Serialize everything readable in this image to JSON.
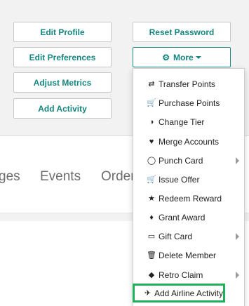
{
  "actions": {
    "edit_profile": "Edit Profile",
    "edit_preferences": "Edit Preferences",
    "adjust_metrics": "Adjust Metrics",
    "add_activity": "Add Activity",
    "reset_password": "Reset Password",
    "more": "More"
  },
  "tabs": [
    "ges",
    "Events",
    "Orders"
  ],
  "menu": [
    {
      "label": "Transfer Points",
      "icon": "transfer-icon",
      "submenu": false
    },
    {
      "label": "Purchase Points",
      "icon": "cart-icon",
      "submenu": false
    },
    {
      "label": "Change Tier",
      "icon": "half-circle-icon",
      "submenu": false
    },
    {
      "label": "Merge Accounts",
      "icon": "handshake-icon",
      "submenu": false
    },
    {
      "label": "Punch Card",
      "icon": "tag-icon",
      "submenu": true
    },
    {
      "label": "Issue Offer",
      "icon": "cart-plus-icon",
      "submenu": false
    },
    {
      "label": "Redeem Reward",
      "icon": "star-icon",
      "submenu": false
    },
    {
      "label": "Grant Award",
      "icon": "gift-icon",
      "submenu": false
    },
    {
      "label": "Gift Card",
      "icon": "credit-card-icon",
      "submenu": true
    },
    {
      "label": "Delete Member",
      "icon": "trash-icon",
      "submenu": false
    },
    {
      "label": "Retro Claim",
      "icon": "ticket-icon",
      "submenu": true
    },
    {
      "label": "Add Airline Activity",
      "icon": "airplane-icon",
      "submenu": false,
      "highlighted": true
    }
  ],
  "colors": {
    "accent": "#16857f",
    "highlight": "#1db25a"
  }
}
